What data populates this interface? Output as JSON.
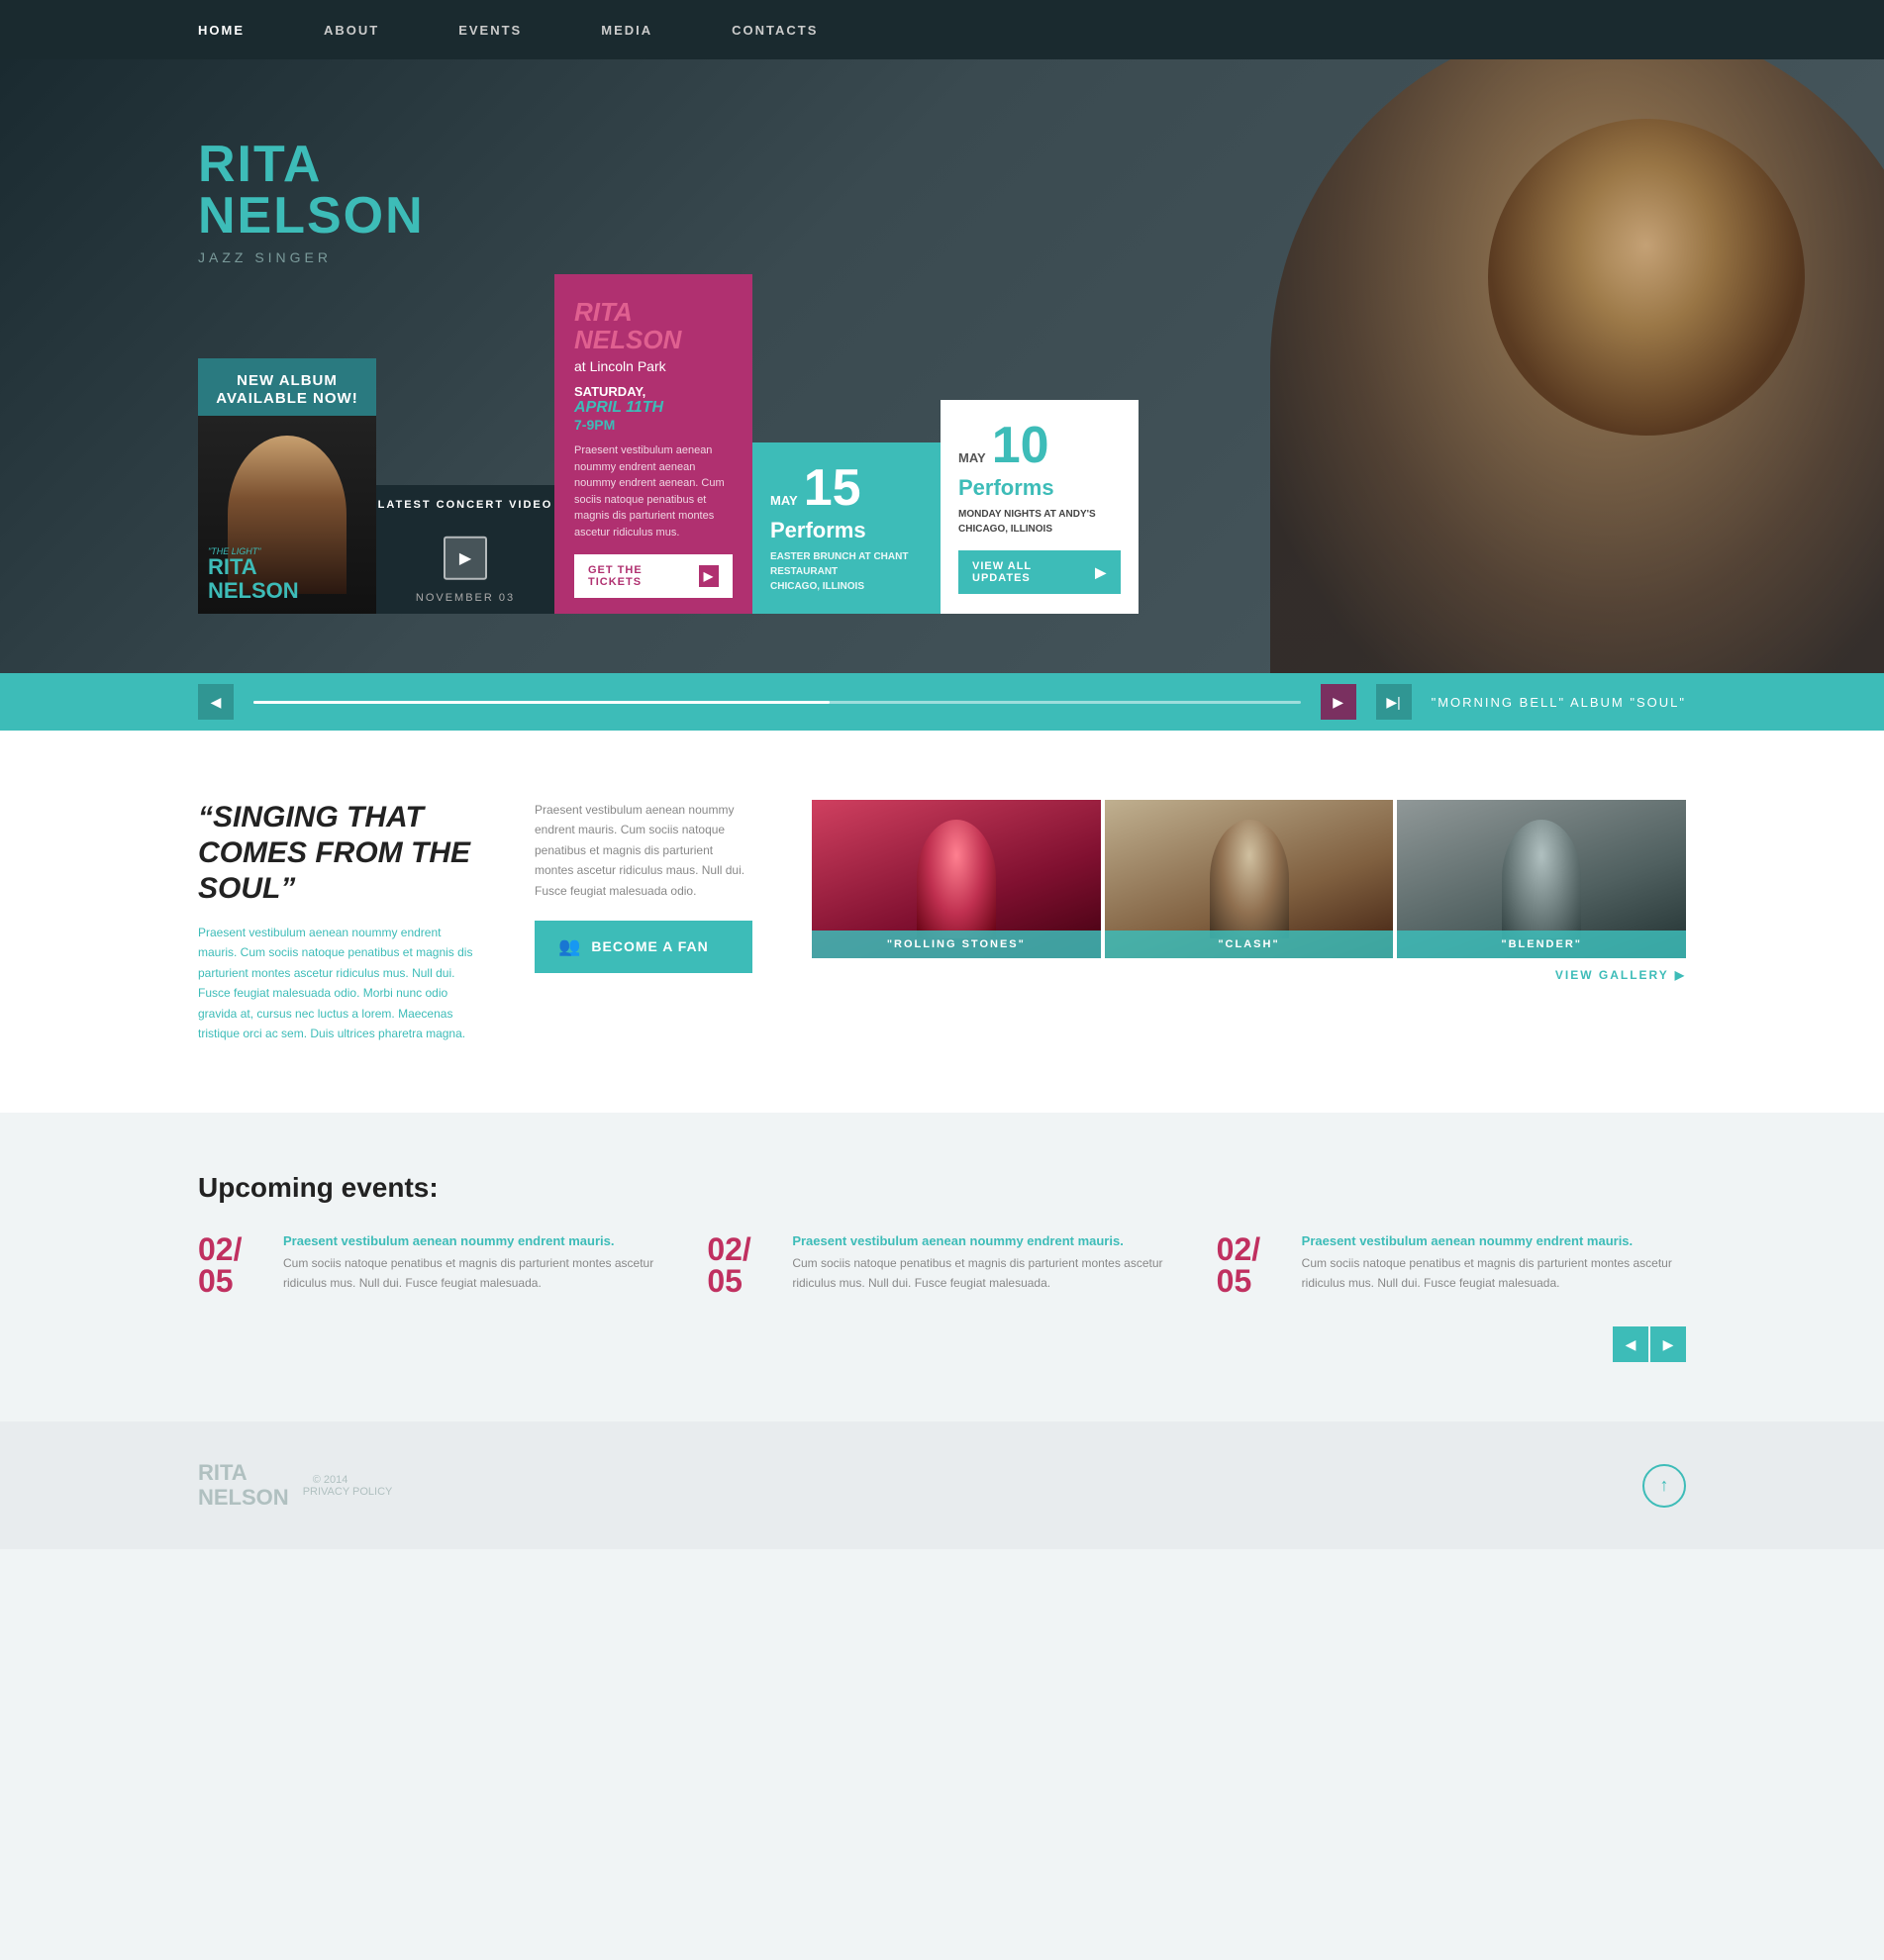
{
  "nav": {
    "items": [
      {
        "label": "HOME",
        "active": true
      },
      {
        "label": "ABOUT",
        "active": false
      },
      {
        "label": "EVENTS",
        "active": false
      },
      {
        "label": "MEDIA",
        "active": false
      },
      {
        "label": "CONTACTS",
        "active": false
      }
    ]
  },
  "hero": {
    "artist_first": "RITA",
    "artist_last": "NELSON",
    "subtitle": "JAZZ SINGER"
  },
  "album_card": {
    "label": "NEW ALBUM AVAILABLE NOW!",
    "the_light": "\"THE LIGHT\"",
    "rita": "RITA",
    "nelson": "NELSON"
  },
  "video_card": {
    "label": "LATEST CONCERT VIDEO",
    "date": "NOVEMBER 03"
  },
  "event_pink": {
    "artist_name": "RITA NELSON",
    "location": "at Lincoln Park",
    "day_name": "SATURDAY,",
    "date": "APRIL 11TH",
    "time": "7-9PM",
    "description": "Praesent vestibulum aenean noummy endrent aenean noummy endrent aenean. Cum sociis natoque penatibus et magnis dis parturient montes ascetur ridiculus mus.",
    "tickets_btn": "GET THE TICKETS"
  },
  "event_teal": {
    "may": "MAY",
    "day": "15",
    "performs": "Performs",
    "desc_line1": "EASTER BRUNCH AT CHANT RESTAURANT",
    "desc_line2": "CHICAGO, ILLINOIS"
  },
  "event_white": {
    "may": "MAY",
    "day": "10",
    "performs": "Performs",
    "desc_line1": "MONDAY NIGHTS AT ANDY'S",
    "desc_line2": "CHICAGO, ILLINOIS",
    "view_all": "VIEW ALL UPDATES"
  },
  "slider": {
    "label": "\"MORNING BELL\" ALBUM \"SOUL\""
  },
  "quote_section": {
    "quote": "“SINGING THAT COMES FROM THE SOUL”",
    "quote_text": "Praesent vestibulum aenean noummy endrent mauris. Cum sociis natoque penatibus et magnis dis parturient montes ascetur ridiculus mus. Null dui. Fusce feugiat malesuada odio. Morbi nunc odio gravida at, cursus nec luctus a lorem. Maecenas tristique orci ac sem. Duis ultrices pharetra magna.",
    "body_text": "Praesent vestibulum aenean noummy endrent mauris. Cum sociis natoque penatibus et magnis dis parturient montes ascetur ridiculus maus. Null dui. Fusce feugiat malesuada odio.",
    "become_fan": "BECOME A FAN"
  },
  "gallery": {
    "items": [
      {
        "label": "\"ROLLING STONES\""
      },
      {
        "label": "\"CLASH\""
      },
      {
        "label": "\"BLENDER\""
      }
    ],
    "view_gallery": "VIEW GALLERY"
  },
  "events_section": {
    "title": "Upcoming events:",
    "items": [
      {
        "date_top": "02/",
        "date_bot": "05",
        "title": "Praesent vestibulum aenean noummy endrent mauris.",
        "body": "Cum sociis natoque penatibus et magnis dis parturient montes ascetur ridiculus mus. Null dui. Fusce feugiat malesuada."
      },
      {
        "date_top": "02/",
        "date_bot": "05",
        "title": "Praesent vestibulum aenean noummy endrent mauris.",
        "body": "Cum sociis natoque penatibus et magnis dis parturient montes ascetur ridiculus mus. Null dui. Fusce feugiat malesuada."
      },
      {
        "date_top": "02/",
        "date_bot": "05",
        "title": "Praesent vestibulum aenean noummy endrent mauris.",
        "body": "Cum sociis natoque penatibus et magnis dis parturient montes ascetur ridiculus mus. Null dui. Fusce feugiat malesuada."
      }
    ]
  },
  "footer": {
    "name_line1": "RITA",
    "name_line2": "NELSON",
    "copyright": "© 2014",
    "privacy": "PRIVACY POLICY"
  },
  "colors": {
    "teal": "#3dbcb8",
    "pink": "#b03070",
    "dark": "#1a2a2f"
  }
}
